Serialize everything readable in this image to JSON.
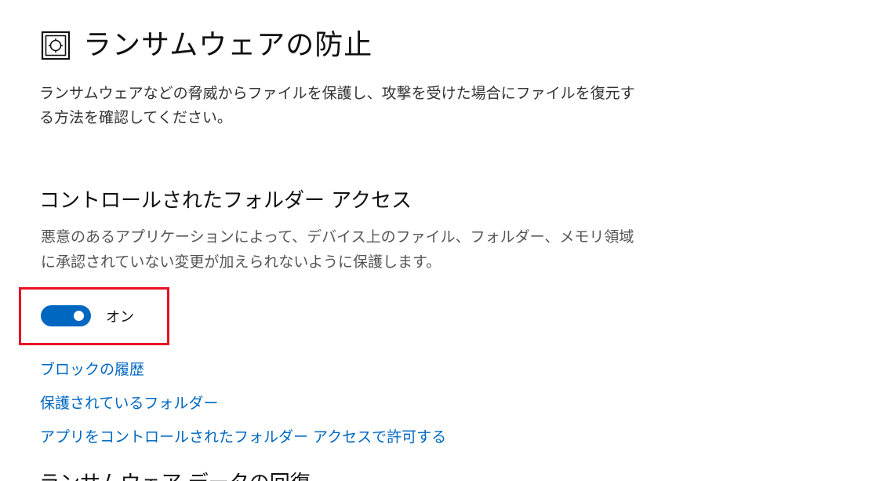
{
  "header": {
    "title": "ランサムウェアの防止",
    "icon": "ransomware-protection-icon"
  },
  "description": "ランサムウェアなどの脅威からファイルを保護し、攻撃を受けた場合にファイルを復元する方法を確認してください。",
  "controlled_folder_access": {
    "title": "コントロールされたフォルダー アクセス",
    "description": "悪意のあるアプリケーションによって、デバイス上のファイル、フォルダー、メモリ領域に承認されていない変更が加えられないように保護します。",
    "toggle": {
      "state": "on",
      "label": "オン"
    },
    "links": [
      {
        "label": "ブロックの履歴"
      },
      {
        "label": "保護されているフォルダー"
      },
      {
        "label": "アプリをコントロールされたフォルダー アクセスで許可する"
      }
    ]
  },
  "next_section": {
    "title": "ランサムウェア データの回復"
  },
  "colors": {
    "accent": "#0067c0",
    "highlight": "#e81123"
  }
}
